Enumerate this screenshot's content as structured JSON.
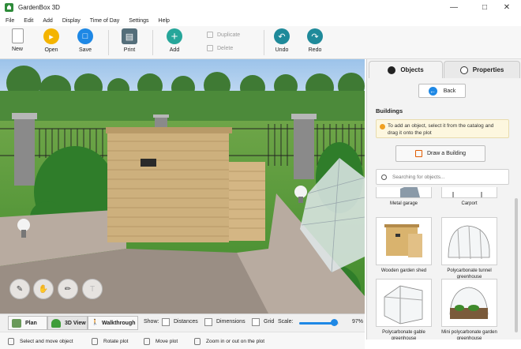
{
  "window": {
    "title": "GardenBox 3D",
    "minimize": "—",
    "maximize": "□",
    "close": "✕"
  },
  "menu": [
    "File",
    "Edit",
    "Add",
    "Display",
    "Time of Day",
    "Settings",
    "Help"
  ],
  "toolbar": {
    "new": "New",
    "open": "Open",
    "save": "Save",
    "print": "Print",
    "add": "Add",
    "duplicate": "Duplicate",
    "delete": "Delete",
    "undo": "Undo",
    "redo": "Redo"
  },
  "panel": {
    "tabs": {
      "objects": "Objects",
      "properties": "Properties"
    },
    "back": "Back",
    "section": "Buildings",
    "hint": "To add an object, select it from the catalog and drag it onto the plot",
    "draw_building": "Draw a Building",
    "search_placeholder": "Searching for objects...",
    "items": [
      {
        "name": "Metal garage"
      },
      {
        "name": "Carport"
      },
      {
        "name": "Wooden garden shed"
      },
      {
        "name": "Polycarbonate tunnel greenhouse"
      },
      {
        "name": "Polycarbonate gable greenhouse"
      },
      {
        "name": "Mini polycarbonate garden greenhouse"
      }
    ]
  },
  "viewbar": {
    "plan": "Plan",
    "view3d": "3D View",
    "walkthrough": "Walkthrough",
    "show": "Show:",
    "distances": "Distances",
    "dimensions": "Dimensions",
    "grid": "Grid",
    "scale": "Scale:",
    "scale_value": "97%",
    "scale_fraction": 0.88
  },
  "status": {
    "select": "Select and move object",
    "rotate": "Rotate plot",
    "move": "Move plot",
    "zoom": "Zoom in or out on the plot"
  },
  "colors": {
    "accent": "#1e88e5",
    "green": "#2e9e44",
    "open_yellow": "#f4b400",
    "add_teal": "#26a69a"
  }
}
